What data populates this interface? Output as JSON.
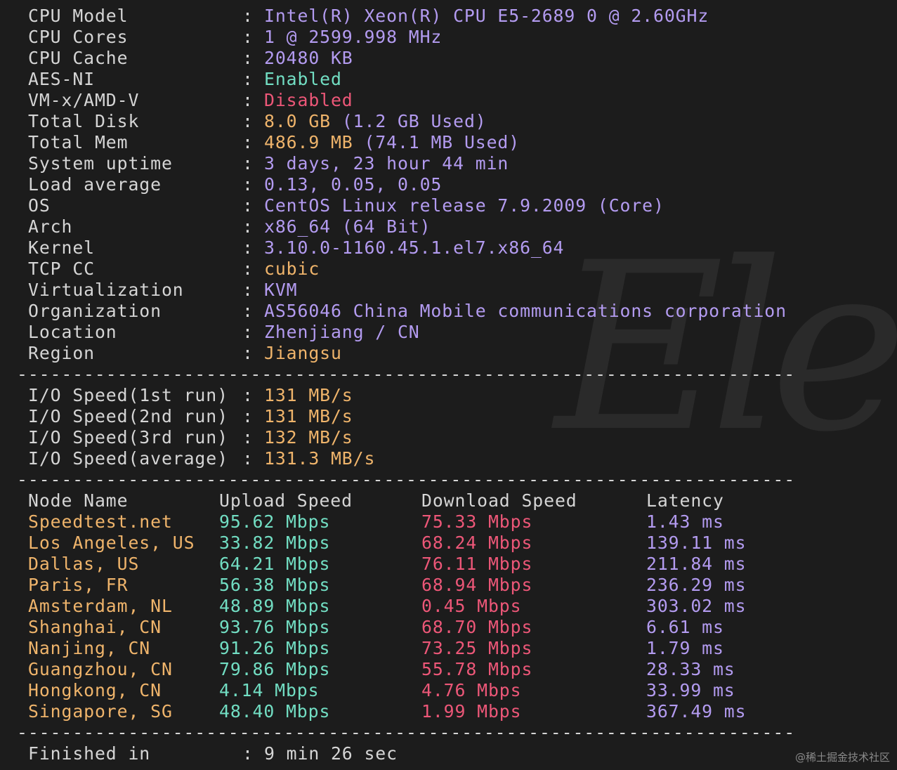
{
  "system_info": [
    {
      "label": "CPU Model",
      "value": "Intel(R) Xeon(R) CPU E5-2689 0 @ 2.60GHz",
      "color": "#b39bf0"
    },
    {
      "label": "CPU Cores",
      "value": "1 @ 2599.998 MHz",
      "color": "#b39bf0"
    },
    {
      "label": "CPU Cache",
      "value": "20480 KB",
      "color": "#b39bf0"
    },
    {
      "label": "AES-NI",
      "value": "Enabled",
      "color": "#72dec3"
    },
    {
      "label": "VM-x/AMD-V",
      "value": "Disabled",
      "color": "#ed5778"
    },
    {
      "label": "Total Disk",
      "value_main": "8.0 GB",
      "value_sub": "(1.2 GB Used)",
      "color": "#efb46b"
    },
    {
      "label": "Total Mem",
      "value_main": "486.9 MB",
      "value_sub": "(74.1 MB Used)",
      "color": "#efb46b"
    },
    {
      "label": "System uptime",
      "value": "3 days, 23 hour 44 min",
      "color": "#b39bf0"
    },
    {
      "label": "Load average",
      "value": "0.13, 0.05, 0.05",
      "color": "#b39bf0"
    },
    {
      "label": "OS",
      "value": "CentOS Linux release 7.9.2009 (Core)",
      "color": "#b39bf0"
    },
    {
      "label": "Arch",
      "value": "x86_64 (64 Bit)",
      "color": "#b39bf0"
    },
    {
      "label": "Kernel",
      "value": "3.10.0-1160.45.1.el7.x86_64",
      "color": "#b39bf0"
    },
    {
      "label": "TCP CC",
      "value": "cubic",
      "color": "#efb46b"
    },
    {
      "label": "Virtualization",
      "value": "KVM",
      "color": "#b39bf0"
    },
    {
      "label": "Organization",
      "value": "AS56046 China Mobile communications corporation",
      "color": "#b39bf0"
    },
    {
      "label": "Location",
      "value": "Zhenjiang / CN",
      "color": "#b39bf0"
    },
    {
      "label": "Region",
      "value": "Jiangsu",
      "color": "#efb46b"
    }
  ],
  "separator": "----------------------------------------------------------------------",
  "io_speed": [
    {
      "label": "I/O Speed(1st run)",
      "value": "131 MB/s"
    },
    {
      "label": "I/O Speed(2nd run)",
      "value": "131 MB/s"
    },
    {
      "label": "I/O Speed(3rd run)",
      "value": "132 MB/s"
    },
    {
      "label": "I/O Speed(average)",
      "value": "131.3 MB/s"
    }
  ],
  "speed_table": {
    "headers": [
      "Node Name",
      "Upload Speed",
      "Download Speed",
      "Latency"
    ],
    "rows": [
      {
        "node": "Speedtest.net",
        "upload": "95.62 Mbps",
        "download": "75.33 Mbps",
        "latency": "1.43 ms"
      },
      {
        "node": "Los Angeles, US",
        "upload": "33.82 Mbps",
        "download": "68.24 Mbps",
        "latency": "139.11 ms"
      },
      {
        "node": "Dallas, US",
        "upload": "64.21 Mbps",
        "download": "76.11 Mbps",
        "latency": "211.84 ms"
      },
      {
        "node": "Paris, FR",
        "upload": "56.38 Mbps",
        "download": "68.94 Mbps",
        "latency": "236.29 ms"
      },
      {
        "node": "Amsterdam, NL",
        "upload": "48.89 Mbps",
        "download": "0.45 Mbps",
        "latency": "303.02 ms"
      },
      {
        "node": "Shanghai, CN",
        "upload": "93.76 Mbps",
        "download": "68.70 Mbps",
        "latency": "6.61 ms"
      },
      {
        "node": "Nanjing, CN",
        "upload": "91.26 Mbps",
        "download": "73.25 Mbps",
        "latency": "1.79 ms"
      },
      {
        "node": "Guangzhou, CN",
        "upload": "79.86 Mbps",
        "download": "55.78 Mbps",
        "latency": "28.33 ms"
      },
      {
        "node": "Hongkong, CN",
        "upload": "4.14 Mbps",
        "download": "4.76 Mbps",
        "latency": "33.99 ms"
      },
      {
        "node": "Singapore, SG",
        "upload": "48.40 Mbps",
        "download": "1.99 Mbps",
        "latency": "367.49 ms"
      }
    ]
  },
  "finished": {
    "label": "Finished in",
    "value": "9 min 26 sec"
  },
  "watermark": "@稀土掘金技术社区",
  "background_logo": "Ele"
}
